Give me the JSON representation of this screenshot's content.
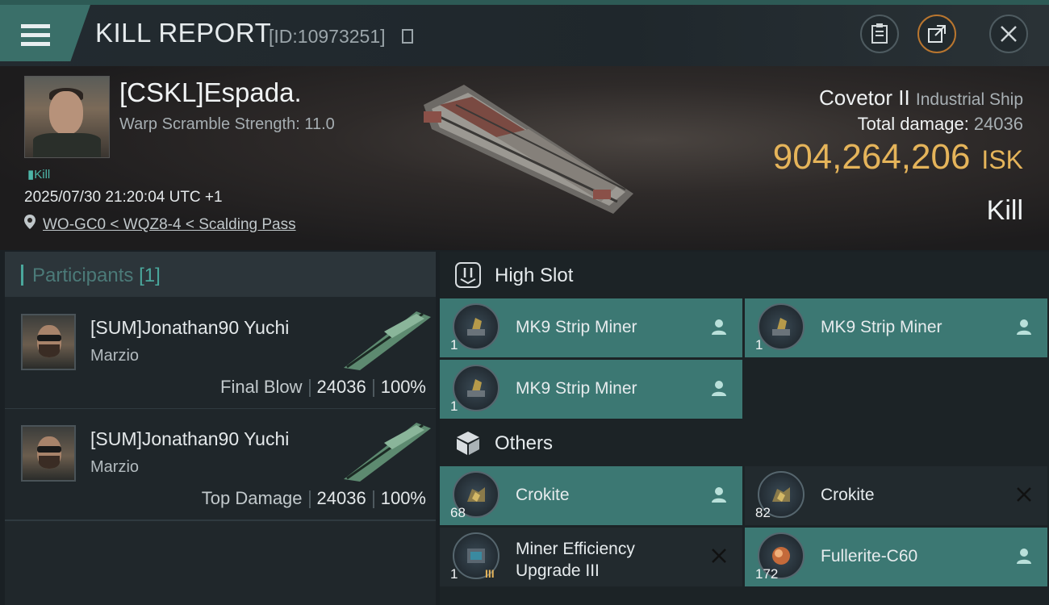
{
  "header": {
    "title": "KILL REPORT",
    "report_id": "[ID:10973251]",
    "menu_icon": "hamburger-menu-icon",
    "buttons": [
      "clipboard-icon",
      "share-icon",
      "close-icon"
    ],
    "accent_color": "#3a6f69"
  },
  "victim": {
    "name": "[CSKL]Espada.",
    "warp_scramble": "Warp Scramble Strength: 11.0",
    "kill_tag": "Kill",
    "datetime": "2025/07/30 21:20:04 UTC +1",
    "location": "WO-GC0 < WQZ8-4 < Scalding Pass",
    "ship_name": "Covetor II",
    "ship_class": "Industrial Ship",
    "total_damage_label": "Total damage:",
    "total_damage": "24036",
    "isk_value": "904,264,206",
    "isk_unit": "ISK",
    "kill_type": "Kill"
  },
  "participants": {
    "title": "Participants",
    "count": "[1]",
    "rows": [
      {
        "name": "[SUM]Jonathan90 Yuchi",
        "corp": "Marzio",
        "role": "Final Blow",
        "damage": "24036",
        "percent": "100%"
      },
      {
        "name": "[SUM]Jonathan90 Yuchi",
        "corp": "Marzio",
        "role": "Top Damage",
        "damage": "24036",
        "percent": "100%"
      }
    ]
  },
  "fittings": {
    "high_slot_title": "High Slot",
    "others_title": "Others",
    "high_slot": [
      {
        "name": "MK9 Strip Miner",
        "qty": "1",
        "status": "pilot-icon"
      },
      {
        "name": "MK9 Strip Miner",
        "qty": "1",
        "status": "pilot-icon"
      },
      {
        "name": "MK9 Strip Miner",
        "qty": "1",
        "status": "pilot-icon"
      }
    ],
    "others": [
      {
        "name": "Crokite",
        "qty": "68",
        "status": "pilot-icon"
      },
      {
        "name": "Crokite",
        "qty": "82",
        "status": "destroyed-x-icon"
      },
      {
        "name_line1": "Miner Efficiency",
        "name_line2": "Upgrade III",
        "qty": "1",
        "tech": "III",
        "status": "destroyed-x-icon"
      },
      {
        "name": "Fullerite-C60",
        "qty": "172",
        "status": "pilot-icon"
      }
    ]
  }
}
